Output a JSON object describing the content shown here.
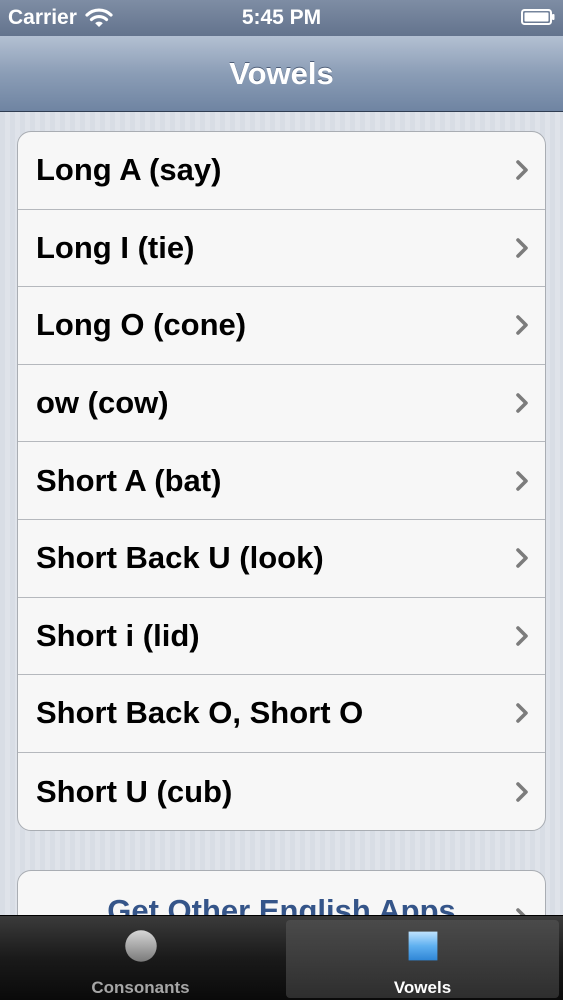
{
  "status_bar": {
    "carrier": "Carrier",
    "time": "5:45 PM"
  },
  "nav_bar": {
    "title": "Vowels"
  },
  "vowel_list": {
    "items": [
      {
        "label": "Long A (say)"
      },
      {
        "label": "Long I (tie)"
      },
      {
        "label": "Long O (cone)"
      },
      {
        "label": "ow (cow)"
      },
      {
        "label": "Short A (bat)"
      },
      {
        "label": "Short Back U (look)"
      },
      {
        "label": "Short i (lid)"
      },
      {
        "label": "Short Back O, Short O"
      },
      {
        "label": "Short U (cub)"
      }
    ]
  },
  "apps_link": {
    "label": "Get Other English Apps"
  },
  "tab_bar": {
    "tabs": [
      {
        "label": "Consonants",
        "icon": "circle-icon",
        "selected": false
      },
      {
        "label": "Vowels",
        "icon": "square-icon",
        "selected": true
      }
    ]
  },
  "colors": {
    "nav_bar": "#8b9db6",
    "link_text": "#355589",
    "tab_bar": "#1a1a1a",
    "selected_tab_icon": "#4d9de0"
  }
}
